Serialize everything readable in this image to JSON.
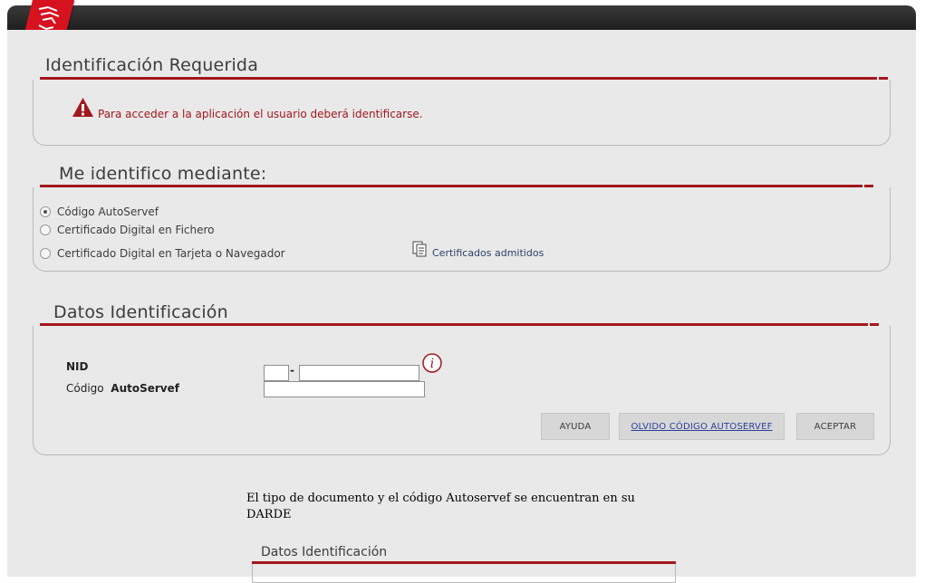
{
  "header": {
    "logo_icon": "generalitat-valenciana-logo-icon"
  },
  "identificacion": {
    "title": "Identificación Requerida",
    "warning_icon": "warning-triangle-icon",
    "message": "Para acceder a la aplicación el usuario deberá identificarse."
  },
  "metodo": {
    "title": "Me identifico mediante:",
    "options": [
      {
        "label": "Código AutoServef",
        "checked": true
      },
      {
        "label": "Certificado Digital en Fichero",
        "checked": false
      },
      {
        "label": "Certificado Digital en Tarjeta o Navegador",
        "checked": false
      }
    ],
    "cert_link": {
      "icon": "documents-icon",
      "label": "Certificados admitidos"
    }
  },
  "datos": {
    "title": "Datos Identificación",
    "nid_label": "NID",
    "codigo_label_1": "Código",
    "codigo_label_2": "AutoServef",
    "separator": "-",
    "info_icon": "info-icon",
    "nid_prefix_value": "",
    "nid_value": "",
    "codigo_value": "",
    "buttons": {
      "ayuda": "AYUDA",
      "olvido": "OLVIDO CÓDIGO AUTOSERVEF",
      "aceptar": "ACEPTAR"
    }
  },
  "note": "El tipo de documento y el código Autoservef se encuentran en su DARDE",
  "datos2": {
    "title": "Datos Identificación"
  },
  "colors": {
    "accent": "#a3171d",
    "logo_red": "#d7121f",
    "background": "#e9e9e9",
    "link": "#2b3f99"
  }
}
